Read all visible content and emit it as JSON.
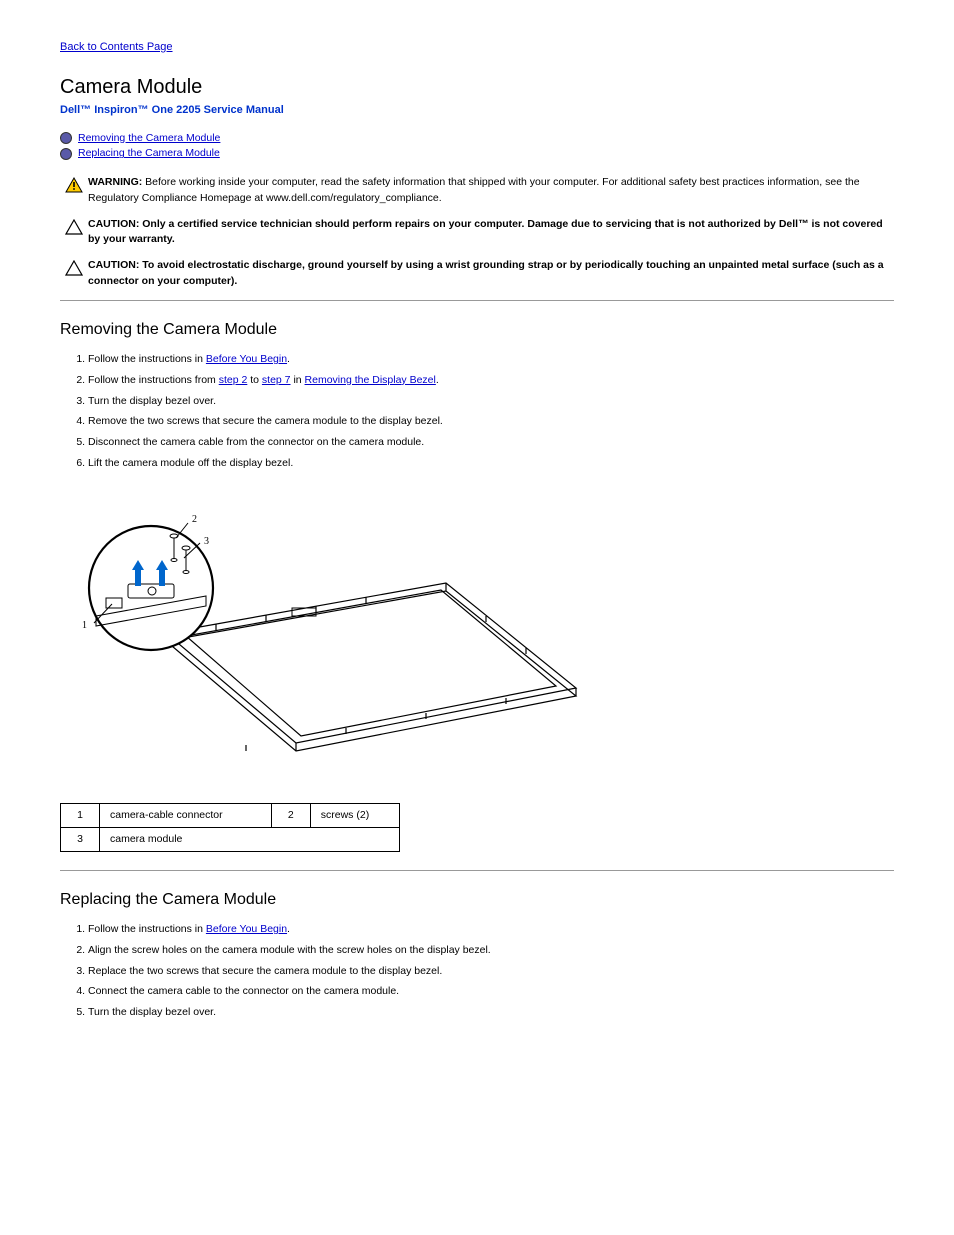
{
  "topLink": "Back to Contents Page",
  "pageTitle": "Camera Module",
  "docTitle": "Dell™ Inspiron™ One 2205 Service Manual",
  "toc": [
    {
      "label": "Removing the Camera Module"
    },
    {
      "label": "Replacing the Camera Module"
    }
  ],
  "warning": {
    "lead": "WARNING:",
    "text": "Before working inside your computer, read the safety information that shipped with your computer. For additional safety best practices information, see the Regulatory Compliance Homepage at www.dell.com/regulatory_compliance."
  },
  "caution1": {
    "lead": "CAUTION:",
    "text": "Only a certified service technician should perform repairs on your computer. Damage due to servicing that is not authorized by Dell™ is not covered by your warranty."
  },
  "caution2": {
    "lead": "CAUTION:",
    "text": "To avoid electrostatic discharge, ground yourself by using a wrist grounding strap or by periodically touching an unpainted metal surface (such as a connector on your computer)."
  },
  "removeTitle": "Removing the Camera Module",
  "removeSteps": {
    "s1": "Follow the instructions in ",
    "s1link": "Before You Begin",
    "s1end": ".",
    "s2a": "Follow the instructions from ",
    "s2link1": "step 2",
    "s2b": " to ",
    "s2link2": "step 7",
    "s2c": " in ",
    "s2link3": "Removing the Display Bezel",
    "s2d": ".",
    "s3": "Turn the display bezel over.",
    "s4": "Remove the two screws that secure the camera module to the display bezel.",
    "s5": "Disconnect the camera cable from the connector on the camera module.",
    "s6": "Lift the camera module off the display bezel."
  },
  "callouts": {
    "r1n": "1",
    "r1t": "camera-cable connector",
    "r2n": "2",
    "r2t": "screws (2)",
    "r3n": "3",
    "r3t": "camera module"
  },
  "replaceTitle": "Replacing the Camera Module",
  "replaceSteps": {
    "s1": "Follow the instructions in ",
    "s1link": "Before You Begin",
    "s1end": ".",
    "s2": "Align the screw holes on the camera module with the screw holes on the display bezel.",
    "s3": "Replace the two screws that secure the camera module to the display bezel.",
    "s4": "Connect the camera cable to the connector on the camera module.",
    "s5": "Turn the display bezel over."
  }
}
